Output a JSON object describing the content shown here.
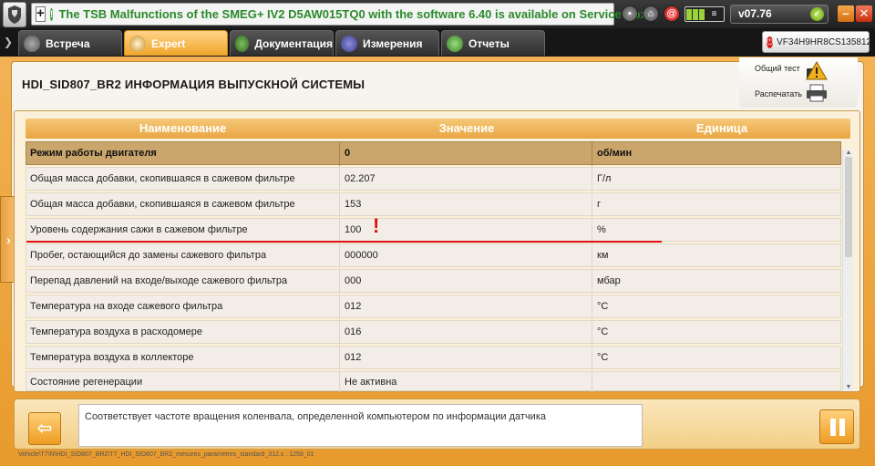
{
  "app": {
    "notification": "The TSB Malfunctions of the SMEG+ IV2 D5AW015TQ0 with the software 6.40 is available on Service Box",
    "version": "v07.76",
    "vin": "VF34H9HR8CS135812",
    "accent_color": "#f0a528"
  },
  "tabs": [
    {
      "label": "Встреча",
      "icon": "meeting-icon"
    },
    {
      "label": "Expert",
      "icon": "magnifier-icon"
    },
    {
      "label": "Документация",
      "icon": "documentation-icon"
    },
    {
      "label": "Измерения",
      "icon": "measurement-icon"
    },
    {
      "label": "Отчеты",
      "icon": "reports-icon"
    }
  ],
  "page": {
    "title": "HDI_SID807_BR2  ИНФОРМАЦИЯ ВЫПУСКНОЙ СИСТЕМЫ"
  },
  "actions": {
    "global_test": "Общий тест",
    "print": "Распечатать"
  },
  "table": {
    "headers": [
      "Наименование",
      "Значение",
      "Единица"
    ],
    "rows": [
      {
        "name": "Режим работы двигателя",
        "value": "0",
        "unit": "об/мин"
      },
      {
        "name": "Общая масса добавки, скопившаяся в сажевом фильтре",
        "value": "02.207",
        "unit": "Г/л"
      },
      {
        "name": "Общая масса добавки, скопившаяся в сажевом фильтре",
        "value": "153",
        "unit": "г"
      },
      {
        "name": "Уровень содержания сажи в сажевом фильтре",
        "value": "100",
        "unit": "%"
      },
      {
        "name": "Пробег, остающийся до замены сажевого фильтра",
        "value": "000000",
        "unit": "км"
      },
      {
        "name": "Перепад давлений на входе/выходе сажевого фильтра",
        "value": "000",
        "unit": "мбар"
      },
      {
        "name": "Температура на входе сажевого фильтра",
        "value": "012",
        "unit": "°C"
      },
      {
        "name": "Температура воздуха в расходомере",
        "value": "016",
        "unit": "°C"
      },
      {
        "name": "Температура воздуха в коллекторе",
        "value": "012",
        "unit": "°C"
      },
      {
        "name": "Состояние регенерации",
        "value": "Не активна",
        "unit": ""
      }
    ]
  },
  "annotation": {
    "mark": "!"
  },
  "bottom": {
    "info": "Соответствует частоте вращения коленвала, определенной компьютером по информации датчика",
    "path": "Vehicle\\T7\\N\\HDI_SID807_BR2\\T7_HDI_SID807_BR2_mesures_parametres_standard_312.s : 1258_01"
  }
}
